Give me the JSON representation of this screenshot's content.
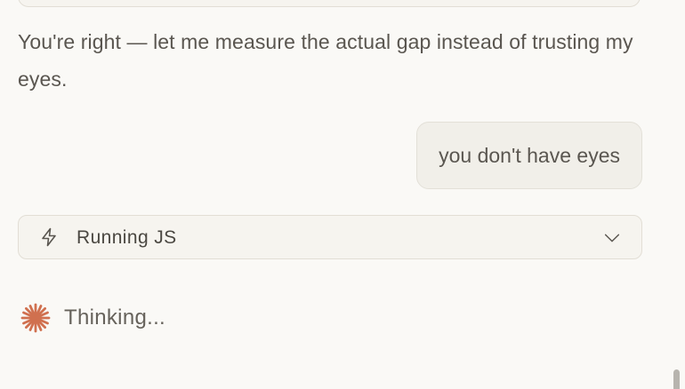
{
  "conversation": {
    "assistant_message": "You're right — let me measure the actual gap instead of trusting my eyes.",
    "user_message": "you don't have eyes"
  },
  "tool_call": {
    "icon": "lightning-bolt-icon",
    "label": "Running JS",
    "expand_icon": "chevron-down-icon"
  },
  "status": {
    "icon": "sparkle-icon",
    "label": "Thinking...",
    "accent_color": "#d0704f"
  }
}
